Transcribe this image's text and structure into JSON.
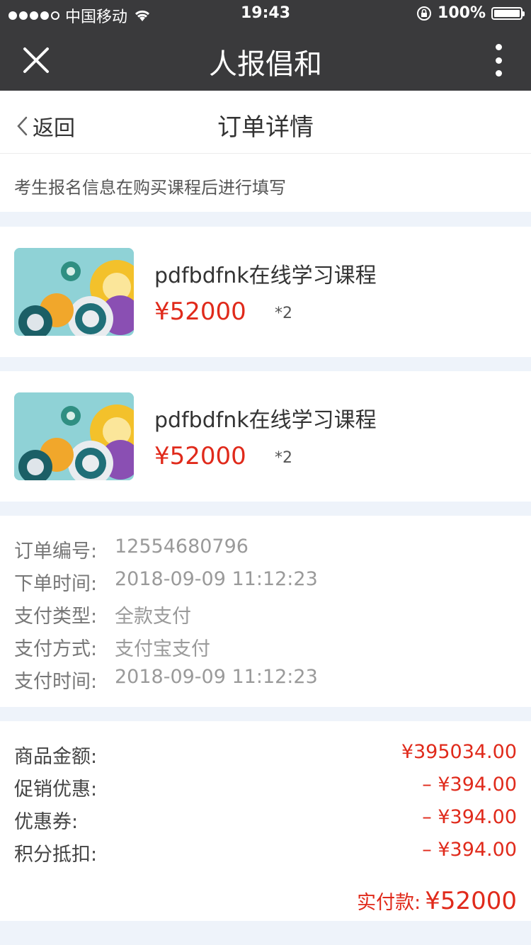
{
  "status_bar": {
    "carrier": "中国移动",
    "time": "19:43",
    "battery": "100%"
  },
  "nav": {
    "title": "人报倡和"
  },
  "header": {
    "back_label": "返回",
    "title": "订单详情"
  },
  "notice": "考生报名信息在购买课程后进行填写",
  "products": [
    {
      "name": "pdfbdfnk在线学习课程",
      "price": "¥52000",
      "qty": "*2"
    },
    {
      "name": "pdfbdfnk在线学习课程",
      "price": "¥52000",
      "qty": "*2"
    }
  ],
  "order_info": [
    {
      "label": "订单编号:",
      "value": "12554680796"
    },
    {
      "label": "下单时间:",
      "value": "2018-09-09 11:12:23"
    },
    {
      "label": "支付类型:",
      "value": "全款支付"
    },
    {
      "label": "支付方式:",
      "value": "支付宝支付"
    },
    {
      "label": "支付时间:",
      "value": "2018-09-09 11:12:23"
    }
  ],
  "amounts": [
    {
      "label": "商品金额:",
      "value": "¥395034.00"
    },
    {
      "label": "促销优惠:",
      "value": "– ¥394.00"
    },
    {
      "label": "优惠券:",
      "value": "– ¥394.00"
    },
    {
      "label": "积分抵扣:",
      "value": "– ¥394.00"
    }
  ],
  "total": {
    "label": "实付款:",
    "value": "¥52000"
  },
  "colors": {
    "accent": "#e02a1b",
    "bar": "#3a3a3c",
    "page_bg": "#eef3fa"
  }
}
